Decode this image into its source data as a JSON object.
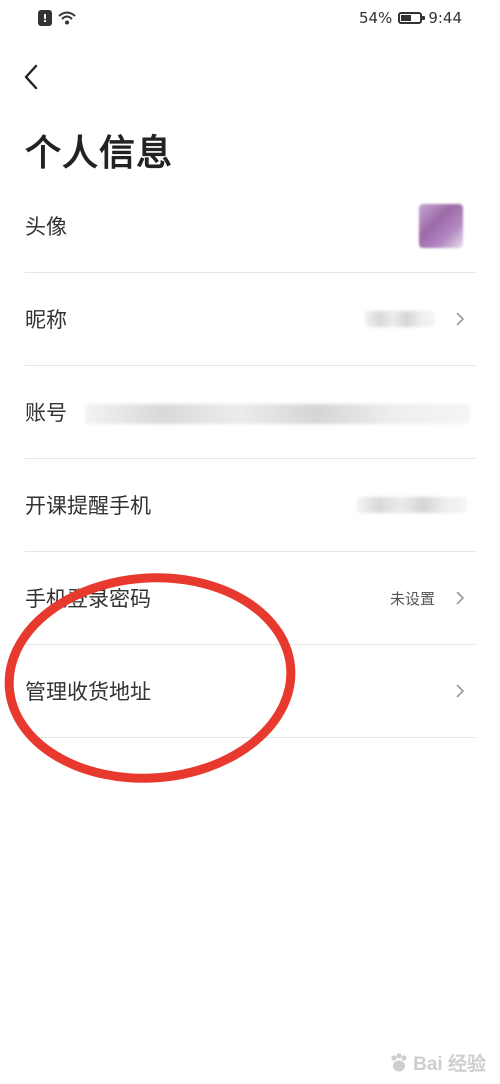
{
  "status_bar": {
    "battery_text": "54%",
    "battery_level": 0.54,
    "time": "9:44",
    "icons": [
      "alert-icon",
      "wifi-icon",
      "battery-icon"
    ]
  },
  "header": {
    "back_icon": "chevron-left-icon",
    "title": "个人信息"
  },
  "rows": [
    {
      "label": "头像"
    },
    {
      "label": "昵称"
    },
    {
      "label": "账号"
    },
    {
      "label": "开课提醒手机"
    },
    {
      "label": "手机登录密码",
      "value": "未设置"
    },
    {
      "label": "管理收货地址"
    }
  ],
  "annotation": {
    "color": "#e8392f"
  },
  "watermark": {
    "text": "Bai 经验"
  },
  "colors": {
    "text_primary": "#333333",
    "divider": "#e5e5e5",
    "annotation": "#e8392f"
  }
}
